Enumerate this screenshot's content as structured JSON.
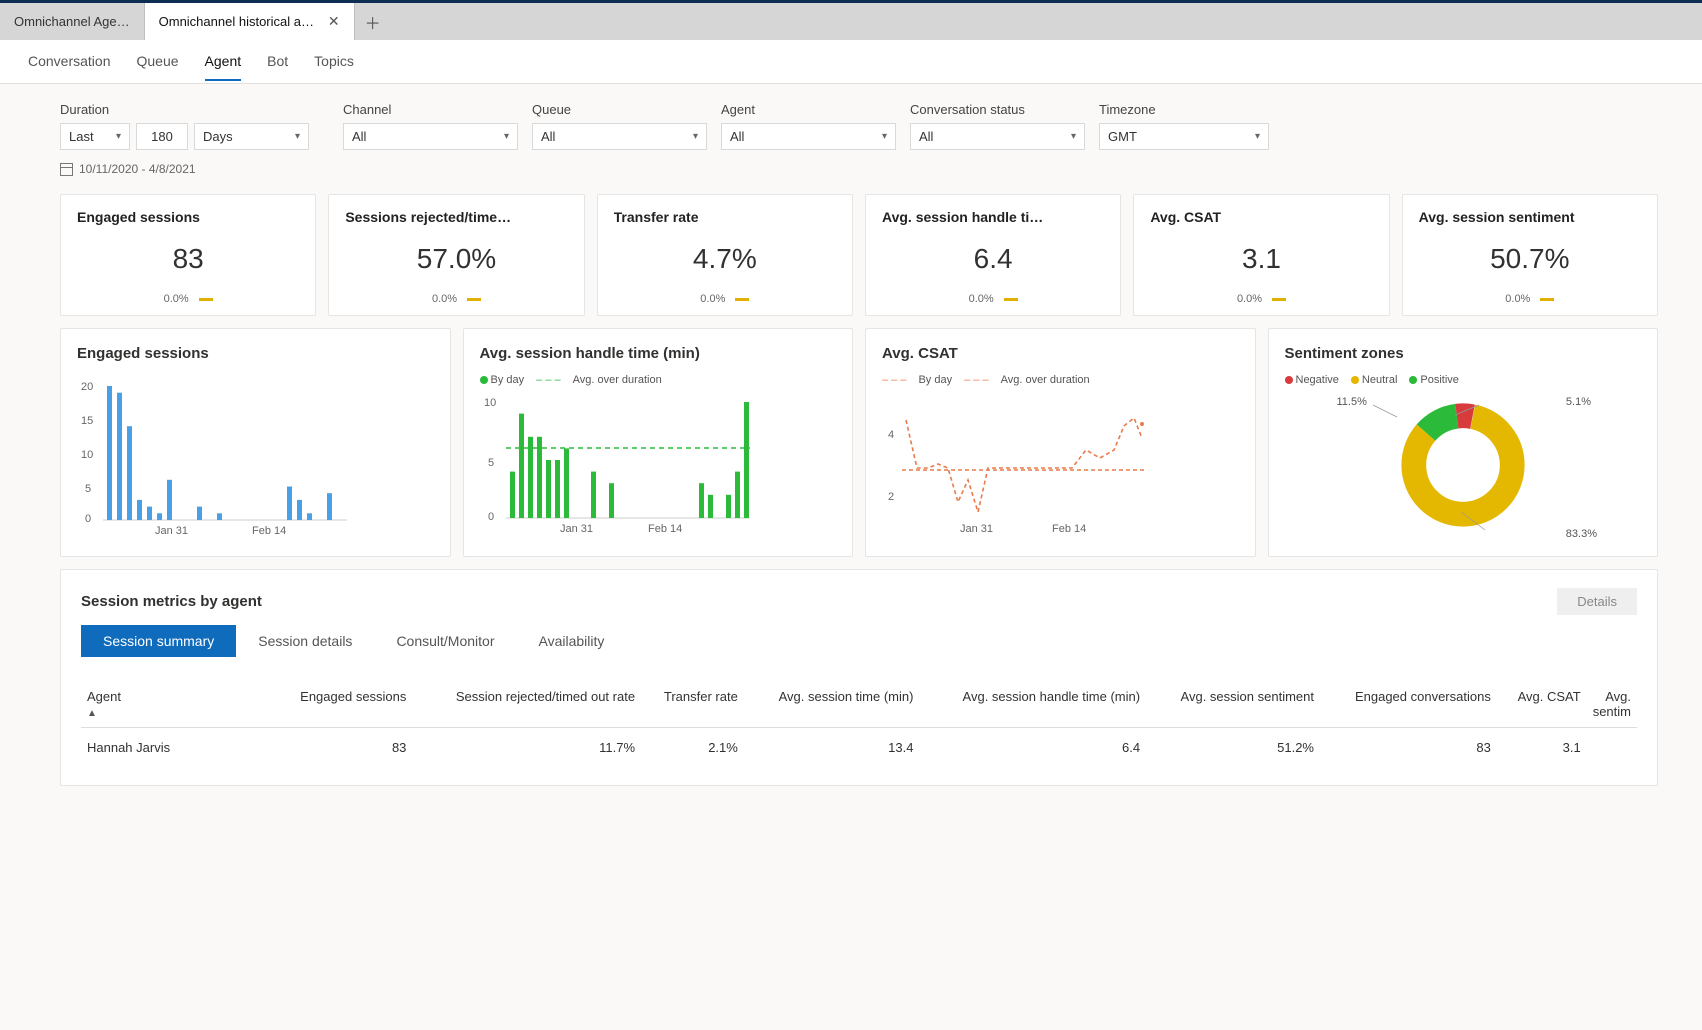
{
  "app_tabs": {
    "inactive": "Omnichannel Age…",
    "active": "Omnichannel historical an…"
  },
  "sub_tabs": [
    "Conversation",
    "Queue",
    "Agent",
    "Bot",
    "Topics"
  ],
  "sub_tab_active": "Agent",
  "filters": {
    "duration_label": "Duration",
    "last": "Last",
    "days_value": "180",
    "days_unit": "Days",
    "channel_label": "Channel",
    "channel_value": "All",
    "queue_label": "Queue",
    "queue_value": "All",
    "agent_label": "Agent",
    "agent_value": "All",
    "status_label": "Conversation status",
    "status_value": "All",
    "tz_label": "Timezone",
    "tz_value": "GMT",
    "date_range": "10/11/2020 - 4/8/2021"
  },
  "kpis": [
    {
      "title": "Engaged sessions",
      "value": "83",
      "delta": "0.0%"
    },
    {
      "title": "Sessions rejected/time…",
      "value": "57.0%",
      "delta": "0.0%"
    },
    {
      "title": "Transfer rate",
      "value": "4.7%",
      "delta": "0.0%"
    },
    {
      "title": "Avg. session handle ti…",
      "value": "6.4",
      "delta": "0.0%"
    },
    {
      "title": "Avg. CSAT",
      "value": "3.1",
      "delta": "0.0%"
    },
    {
      "title": "Avg. session sentiment",
      "value": "50.7%",
      "delta": "0.0%"
    }
  ],
  "charts": {
    "engaged": {
      "title": "Engaged sessions",
      "xticks": [
        "Jan 31",
        "Feb 14"
      ],
      "yticks": [
        "0",
        "5",
        "10",
        "15",
        "20"
      ]
    },
    "handle": {
      "title": "Avg. session handle time (min)",
      "legend_byday": "By day",
      "legend_avg": "Avg. over duration",
      "xticks": [
        "Jan 31",
        "Feb 14"
      ],
      "yticks": [
        "0",
        "5",
        "10"
      ]
    },
    "csat": {
      "title": "Avg. CSAT",
      "legend_byday": "By day",
      "legend_avg": "Avg. over duration",
      "xticks": [
        "Jan 31",
        "Feb 14"
      ],
      "yticks": [
        "2",
        "4"
      ]
    },
    "sentiment": {
      "title": "Sentiment zones",
      "legend_neg": "Negative",
      "legend_neu": "Neutral",
      "legend_pos": "Positive",
      "lab_pos": "11.5%",
      "lab_neg": "5.1%",
      "lab_neu": "83.3%"
    }
  },
  "chart_data": [
    {
      "type": "bar",
      "title": "Engaged sessions",
      "ylim": [
        0,
        20
      ],
      "xticks": [
        "Jan 31",
        "Feb 14"
      ],
      "values": [
        20,
        19,
        14,
        3,
        2,
        1,
        6,
        0,
        0,
        2,
        0,
        1,
        0,
        0,
        0,
        0,
        0,
        0,
        5,
        3,
        1,
        0,
        4
      ]
    },
    {
      "type": "bar",
      "title": "Avg. session handle time (min)",
      "ylim": [
        0,
        10
      ],
      "xticks": [
        "Jan 31",
        "Feb 14"
      ],
      "series": [
        {
          "name": "By day",
          "values": [
            4,
            9,
            7,
            7,
            5,
            5,
            6,
            0,
            0,
            4,
            0,
            3,
            0,
            0,
            0,
            0,
            0,
            0,
            0,
            0,
            0,
            3,
            2,
            0,
            2,
            4,
            10
          ]
        },
        {
          "name": "Avg. over duration",
          "value": 6
        }
      ]
    },
    {
      "type": "line",
      "title": "Avg. CSAT",
      "ylim": [
        2,
        5
      ],
      "xticks": [
        "Jan 31",
        "Feb 14"
      ],
      "series": [
        {
          "name": "By day",
          "values": [
            4.5,
            3.0,
            3.0,
            3.2,
            3.0,
            2.0,
            2.8,
            1.8,
            3.0,
            3.0,
            3.0,
            3.0,
            3.0,
            3.0,
            3.0,
            3.5,
            3.2,
            3.5,
            4.2,
            4.5,
            4.0
          ]
        },
        {
          "name": "Avg. over duration",
          "value": 3.1
        }
      ]
    },
    {
      "type": "pie",
      "title": "Sentiment zones",
      "slices": [
        {
          "name": "Negative",
          "value": 5.1,
          "color": "#d83b3b"
        },
        {
          "name": "Neutral",
          "value": 83.3,
          "color": "#e4b700"
        },
        {
          "name": "Positive",
          "value": 11.5,
          "color": "#2bba3a"
        }
      ]
    }
  ],
  "table_section": {
    "title": "Session metrics by agent",
    "details": "Details",
    "inner_tabs": [
      "Session summary",
      "Session details",
      "Consult/Monitor",
      "Availability"
    ],
    "columns": [
      "Agent",
      "Engaged sessions",
      "Session rejected/timed out rate",
      "Transfer rate",
      "Avg. session time (min)",
      "Avg. session handle time (min)",
      "Avg. session sentiment",
      "Engaged conversations",
      "Avg. CSAT",
      "Avg. sentim"
    ],
    "row": {
      "agent": "Hannah Jarvis",
      "engaged": "83",
      "rejected": "11.7%",
      "transfer": "2.1%",
      "sess_time": "13.4",
      "handle": "6.4",
      "sentiment": "51.2%",
      "conv": "83",
      "csat": "3.1"
    }
  }
}
